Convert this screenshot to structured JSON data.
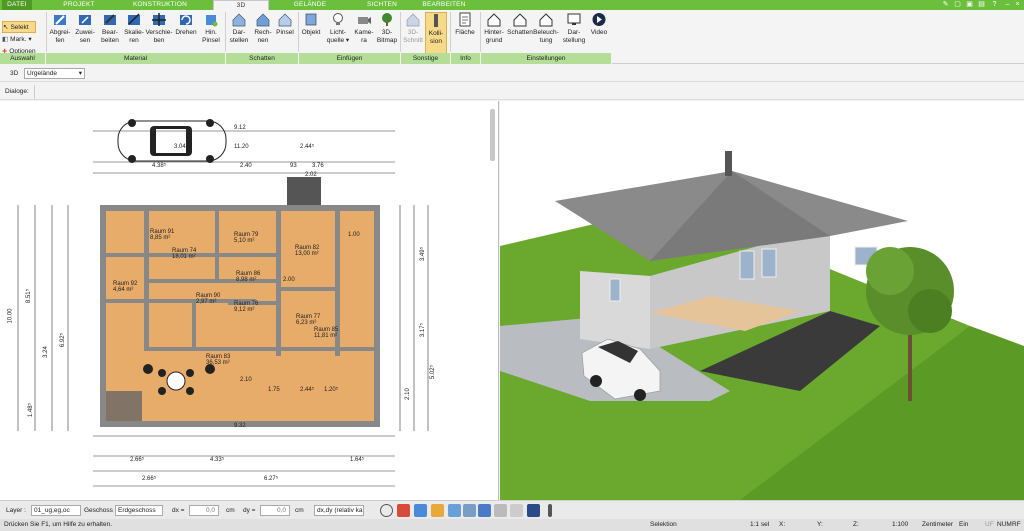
{
  "tabs": [
    {
      "label": "DATEI"
    },
    {
      "label": "PROJEKT"
    },
    {
      "label": "KONSTRUKTION"
    },
    {
      "label": "3D"
    },
    {
      "label": "GELÄNDE"
    },
    {
      "label": "SICHTEN"
    },
    {
      "label": "BEARBEITEN"
    }
  ],
  "selection": {
    "select": "Selekt",
    "mark": "Mark.",
    "options": "Optionen"
  },
  "ribbon": {
    "material": [
      {
        "l1": "Abgrei-",
        "l2": "fen"
      },
      {
        "l1": "Zuwei-",
        "l2": "sen"
      },
      {
        "l1": "Bear-",
        "l2": "beiten"
      },
      {
        "l1": "Skalie-",
        "l2": "ren"
      },
      {
        "l1": "Verschie-",
        "l2": "ben"
      },
      {
        "l1": "Drehen",
        "l2": ""
      },
      {
        "l1": "Hin.",
        "l2": "Pinsel"
      }
    ],
    "schatten": [
      {
        "l1": "Dar-",
        "l2": "stellen"
      },
      {
        "l1": "Rech-",
        "l2": "nen"
      },
      {
        "l1": "Pinsel",
        "l2": ""
      }
    ],
    "einfuegen": [
      {
        "l1": "Objekt",
        "l2": ""
      },
      {
        "l1": "Licht-",
        "l2": "quelle ▾"
      },
      {
        "l1": "Kame-",
        "l2": "ra"
      },
      {
        "l1": "3D-",
        "l2": "Bitmap"
      }
    ],
    "sonstige": [
      {
        "l1": "3D-",
        "l2": "Schnitt"
      },
      {
        "l1": "Kolli-",
        "l2": "sion"
      }
    ],
    "info": [
      {
        "l1": "Fläche",
        "l2": ""
      }
    ],
    "einstellungen": [
      {
        "l1": "Hinter-",
        "l2": "grund"
      },
      {
        "l1": "Schatten",
        "l2": ""
      },
      {
        "l1": "Beleuch-",
        "l2": "tung"
      },
      {
        "l1": "Dar-",
        "l2": "stellung"
      },
      {
        "l1": "Video",
        "l2": ""
      }
    ]
  },
  "groups": {
    "auswahl": "Auswahl",
    "material": "Material",
    "schatten": "Schatten",
    "einfuegen": "Einfügen",
    "sonstige": "Sonstige",
    "info": "Info",
    "einstellungen": "Einstellungen"
  },
  "row2": {
    "mode": "3D",
    "level": "Urgelände"
  },
  "row3": {
    "dialoge": "Dialoge:"
  },
  "plan": {
    "rooms": [
      {
        "name": "Raum 91",
        "area": "8,85 m²"
      },
      {
        "name": "Raum 79",
        "area": "5,10 m²"
      },
      {
        "name": "Raum 82",
        "area": "13,00 m²"
      },
      {
        "name": "Raum 74",
        "area": "18,01 m²"
      },
      {
        "name": "Raum 86",
        "area": "8,98 m²"
      },
      {
        "name": "Raum 92",
        "area": "4,64 m²"
      },
      {
        "name": "Raum 90",
        "area": "2,97 m²"
      },
      {
        "name": "Raum 76",
        "area": "9,12 m²"
      },
      {
        "name": "Raum 77",
        "area": "6,23 m²"
      },
      {
        "name": "Raum 85",
        "area": "11,81 m²"
      },
      {
        "name": "Raum 83",
        "area": "36,53 m²"
      }
    ],
    "dims": {
      "top1": "9.12",
      "top2": "3.04⁵",
      "top3": "11.20",
      "top4": "2.44⁵",
      "top5": "4.38⁵",
      "top6": "2.40",
      "top7": "93",
      "top8": "3.76",
      "top9": "2.02",
      "bot1": "9.32",
      "bot2": "2.66⁵",
      "bot3": "4.33⁵",
      "bot4": "1.64⁵",
      "bot5": "6.27⁵",
      "bot6": "2.66⁵",
      "bot7": "2.10",
      "bot8": "1.75",
      "bot9": "1.20⁵",
      "bot10": "2.44⁵",
      "left1": "10.00",
      "left2": "8.51⁵",
      "left3": "3.24",
      "left4": "1.48⁵",
      "left5": "6.92⁵",
      "right1": "3.49⁵",
      "right2": "3.17⁵",
      "right3": "5.02⁵",
      "right4": "2.10",
      "right5": "1.00",
      "right6": "2.00"
    }
  },
  "status": {
    "layer_label": "Layer :",
    "layer": "01_ug,eg,oc",
    "geschoss_label": "Geschoss :",
    "geschoss": "Erdgeschoss",
    "dx_label": "dx =",
    "dx": "0,0",
    "dy_label": "dy =",
    "dy": "0,0",
    "unit": "cm",
    "mode": "dx,dy (relativ ka"
  },
  "info": {
    "help": "Drücken Sie F1, um Hilfe zu erhalten.",
    "selection": "Selektion",
    "count": "1:1 sel",
    "x": "X:",
    "y": "Y:",
    "z": "Z:",
    "scale": "1:100",
    "units": "Zentimeter",
    "ext": "Ein",
    "uf": "UF",
    "num": "NUM",
    "rf": "RF"
  }
}
